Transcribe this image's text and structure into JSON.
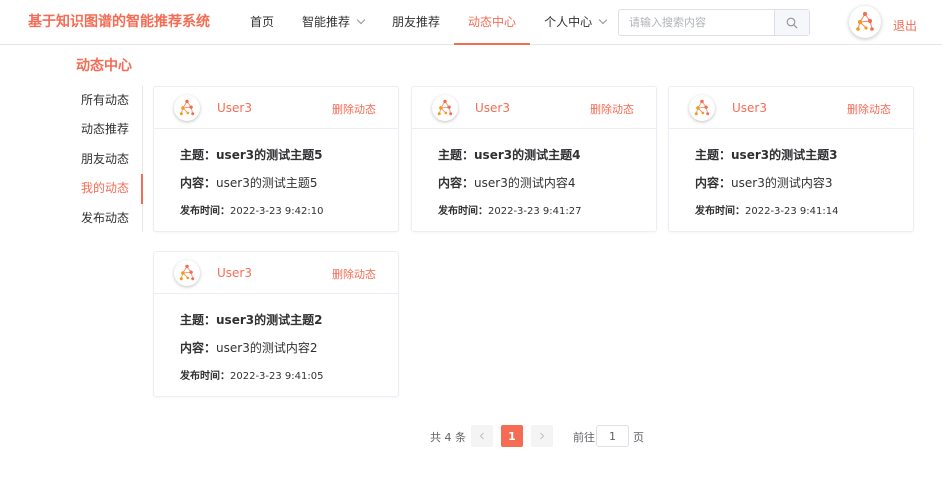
{
  "header": {
    "brand": "基于知识图谱的智能推荐系统",
    "nav": [
      {
        "label": "首页",
        "has_dropdown": false,
        "active": false
      },
      {
        "label": "智能推荐",
        "has_dropdown": true,
        "active": false
      },
      {
        "label": "朋友推荐",
        "has_dropdown": false,
        "active": false
      },
      {
        "label": "动态中心",
        "has_dropdown": false,
        "active": true
      },
      {
        "label": "个人中心",
        "has_dropdown": true,
        "active": false
      }
    ],
    "search_placeholder": "请输入搜索内容",
    "search_icon": "search-icon",
    "avatar_icon": "network-graph-icon",
    "logout": "退出"
  },
  "page_title": "动态中心",
  "side_menu": [
    {
      "label": "所有动态",
      "active": false
    },
    {
      "label": "动态推荐",
      "active": false
    },
    {
      "label": "朋友动态",
      "active": false
    },
    {
      "label": "我的动态",
      "active": true
    },
    {
      "label": "发布动态",
      "active": false
    }
  ],
  "labels": {
    "topic": "主题：",
    "content": "内容：",
    "time": "发布时间：",
    "delete": "删除动态"
  },
  "posts": [
    {
      "user": "User3",
      "topic": "user3的测试主题5",
      "content": "user3的测试主题5",
      "time": "2022-3-23 9:42:10"
    },
    {
      "user": "User3",
      "topic": "user3的测试主题4",
      "content": "user3的测试内容4",
      "time": "2022-3-23 9:41:27"
    },
    {
      "user": "User3",
      "topic": "user3的测试主题3",
      "content": "user3的测试内容3",
      "time": "2022-3-23 9:41:14"
    },
    {
      "user": "User3",
      "topic": "user3的测试主题2",
      "content": "user3的测试内容2",
      "time": "2022-3-23 9:41:05"
    }
  ],
  "pagination": {
    "total": "共 4 条",
    "current_page": "1",
    "goto_label": "前往",
    "goto_value": "1",
    "goto_suffix": "页"
  },
  "colors": {
    "accent": "#f56c55",
    "text": "#303133",
    "border": "#ebeef5"
  }
}
